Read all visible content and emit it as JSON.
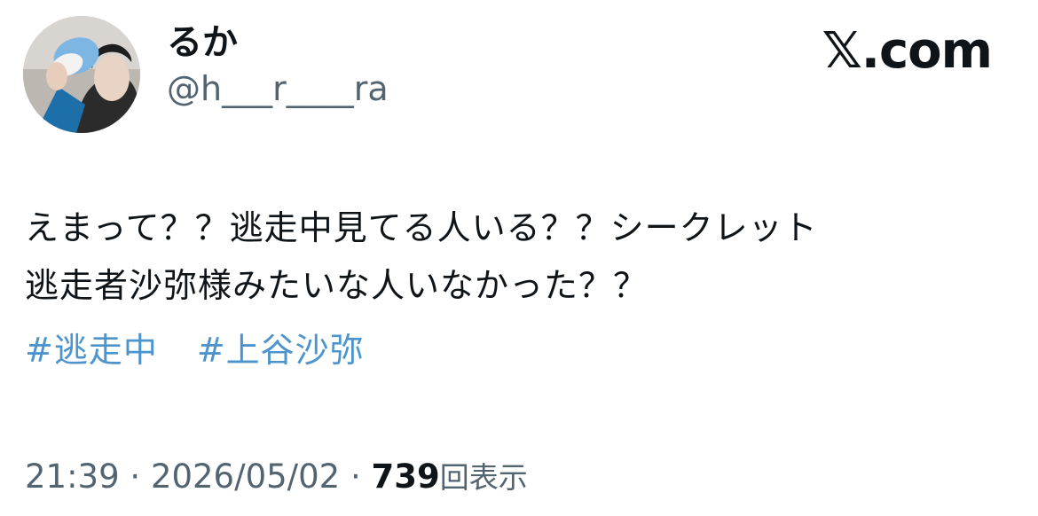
{
  "author": {
    "display_name": "るか",
    "handle": "@h___r____ra"
  },
  "brand": {
    "label": "𝕏.com"
  },
  "tweet": {
    "lines": [
      "えまって？？逃走中見てる人いる？？シークレット",
      "逃走者沙弥様みたいな人いなかった？？"
    ],
    "hashtags": [
      "#逃走中",
      "#上谷沙弥"
    ]
  },
  "meta": {
    "time": "21:39",
    "separator": "·",
    "date": "2026/05/02",
    "views_count": "739",
    "views_label": "回表示"
  },
  "colors": {
    "text": "#0f1419",
    "secondary": "#536471",
    "link": "#4d94cc"
  }
}
